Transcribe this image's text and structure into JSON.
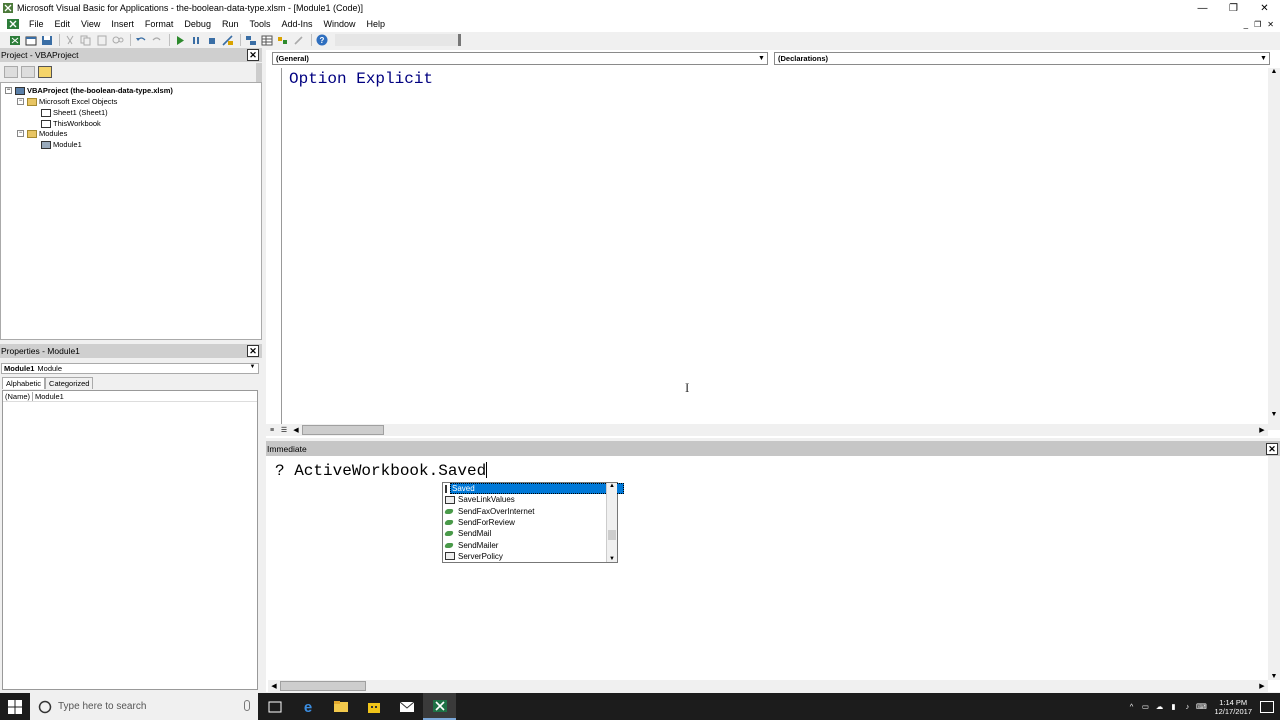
{
  "window": {
    "title": "Microsoft Visual Basic for Applications - the-boolean-data-type.xlsm - [Module1 (Code)]",
    "controls": [
      "—",
      "❐",
      "✕"
    ]
  },
  "menu": {
    "items": [
      "File",
      "Edit",
      "View",
      "Insert",
      "Format",
      "Debug",
      "Run",
      "Tools",
      "Add-Ins",
      "Window",
      "Help"
    ],
    "mdi_controls": [
      "_",
      "❐",
      "✕"
    ]
  },
  "project_panel": {
    "title": "Project - VBAProject",
    "tree": [
      {
        "toggle": "−",
        "icon": "vba-project-icon",
        "label": "VBAProject (the-boolean-data-type.xlsm)"
      },
      {
        "toggle": "−",
        "icon": "folder-icon",
        "label": "Microsoft Excel Objects"
      },
      {
        "toggle": "",
        "icon": "sheet-icon",
        "label": "Sheet1 (Sheet1)"
      },
      {
        "toggle": "",
        "icon": "workbook-icon",
        "label": "ThisWorkbook"
      },
      {
        "toggle": "−",
        "icon": "folder-icon",
        "label": "Modules"
      },
      {
        "toggle": "",
        "icon": "module-icon",
        "label": "Module1"
      }
    ]
  },
  "properties_panel": {
    "title": "Properties - Module1",
    "object_name": "Module1",
    "object_type": "Module",
    "tabs": [
      "Alphabetic",
      "Categorized"
    ],
    "rows": [
      {
        "key": "(Name)",
        "value": "Module1"
      }
    ]
  },
  "code_window": {
    "object_combo": "(General)",
    "procedure_combo": "(Declarations)",
    "code": "Option Explicit"
  },
  "immediate_window": {
    "title": "Immediate",
    "text": "? ActiveWorkbook.Saved"
  },
  "autocomplete": {
    "items": [
      {
        "label": "Saved",
        "kind": "property",
        "selected": true
      },
      {
        "label": "SaveLinkValues",
        "kind": "property"
      },
      {
        "label": "SendFaxOverInternet",
        "kind": "method"
      },
      {
        "label": "SendForReview",
        "kind": "method"
      },
      {
        "label": "SendMail",
        "kind": "method"
      },
      {
        "label": "SendMailer",
        "kind": "method"
      },
      {
        "label": "ServerPolicy",
        "kind": "property"
      }
    ]
  },
  "taskbar": {
    "search_placeholder": "Type here to search",
    "time": "1:14 PM",
    "date": "12/17/2017"
  }
}
